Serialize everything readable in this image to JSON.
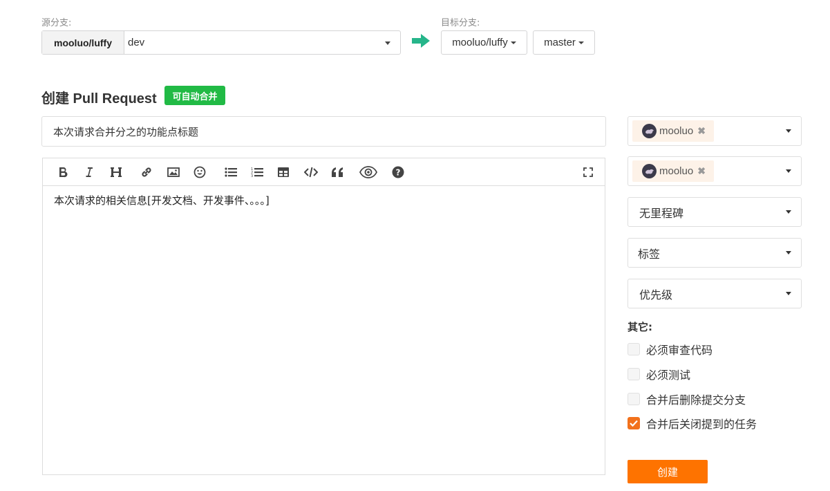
{
  "source": {
    "label": "源分支:",
    "repo": "mooluo/luffy",
    "branch": "dev"
  },
  "target": {
    "label": "目标分支:",
    "repo": "mooluo/luffy",
    "branch": "master"
  },
  "page": {
    "title": "创建 Pull Request",
    "badge": "可自动合并"
  },
  "pr": {
    "title": "本次请求合并分之的功能点标题",
    "body": "本次请求的相关信息[开发文档、开发事件、。。。]"
  },
  "toolbar": {
    "items": [
      "bold",
      "italic",
      "heading",
      "link",
      "image",
      "emoji",
      "unordered-list",
      "ordered-list",
      "table",
      "code",
      "quote",
      "preview",
      "help",
      "fullscreen"
    ]
  },
  "sidebar": {
    "reviewer": "mooluo",
    "tester": "mooluo",
    "milestone": "无里程碑",
    "labels": "标签",
    "priority": "优先级",
    "other_label": "其它:",
    "options": [
      {
        "label": "必须审查代码",
        "checked": false
      },
      {
        "label": "必须测试",
        "checked": false
      },
      {
        "label": "合并后删除提交分支",
        "checked": false
      },
      {
        "label": "合并后关闭提到的任务",
        "checked": true
      }
    ],
    "create_label": "创建"
  },
  "colors": {
    "accent": "#fe7300",
    "badge": "#21ba45",
    "arrow": "#26b58a"
  }
}
